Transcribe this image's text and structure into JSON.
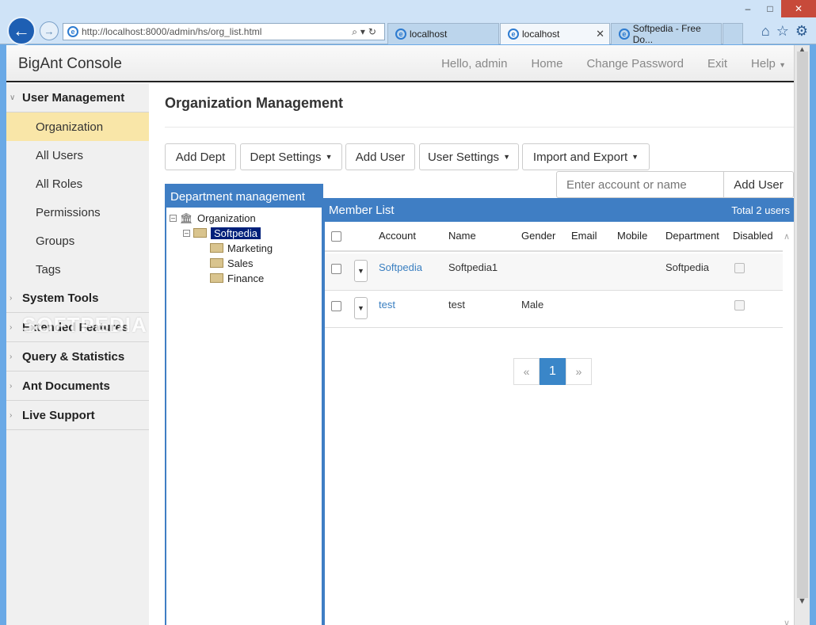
{
  "browser": {
    "url": "http://localhost:8000/admin/hs/org_list.html",
    "tabs": [
      {
        "label": "localhost"
      },
      {
        "label": "localhost"
      },
      {
        "label": "Softpedia - Free Do..."
      }
    ]
  },
  "topnav": {
    "brand": "BigAnt Console",
    "links": [
      "Hello, admin",
      "Home",
      "Change Password",
      "Exit",
      "Help"
    ]
  },
  "sidebar": {
    "sections": [
      {
        "label": "User Management",
        "items": [
          "Organization",
          "All Users",
          "All Roles",
          "Permissions",
          "Groups",
          "Tags"
        ]
      },
      {
        "label": "System Tools"
      },
      {
        "label": "Extended Features"
      },
      {
        "label": "Query & Statistics"
      },
      {
        "label": "Ant Documents"
      },
      {
        "label": "Live Support"
      }
    ],
    "watermark": "SOFTPEDIA"
  },
  "main": {
    "title": "Organization Management",
    "buttons": [
      "Add Dept",
      "Dept Settings",
      "Add User",
      "User Settings",
      "Import and Export"
    ],
    "search": {
      "placeholder": "Enter account or name",
      "button": "Add User"
    }
  },
  "dept_panel": {
    "title": "Department management",
    "tree": {
      "root": "Organization",
      "selected": "Softpedia",
      "children": [
        "Marketing",
        "Sales",
        "Finance"
      ]
    }
  },
  "member_panel": {
    "title": "Member List",
    "total": "Total 2 users",
    "columns": [
      "Account",
      "Name",
      "Gender",
      "Email",
      "Mobile",
      "Department",
      "Disabled"
    ],
    "rows": [
      {
        "account": "Softpedia",
        "name": "Softpedia1",
        "gender": "",
        "email": "",
        "mobile": "",
        "department": "Softpedia"
      },
      {
        "account": "test",
        "name": "test",
        "gender": "Male",
        "email": "",
        "mobile": "",
        "department": ""
      }
    ],
    "pager": {
      "prev": "«",
      "current": "1",
      "next": "»"
    }
  }
}
